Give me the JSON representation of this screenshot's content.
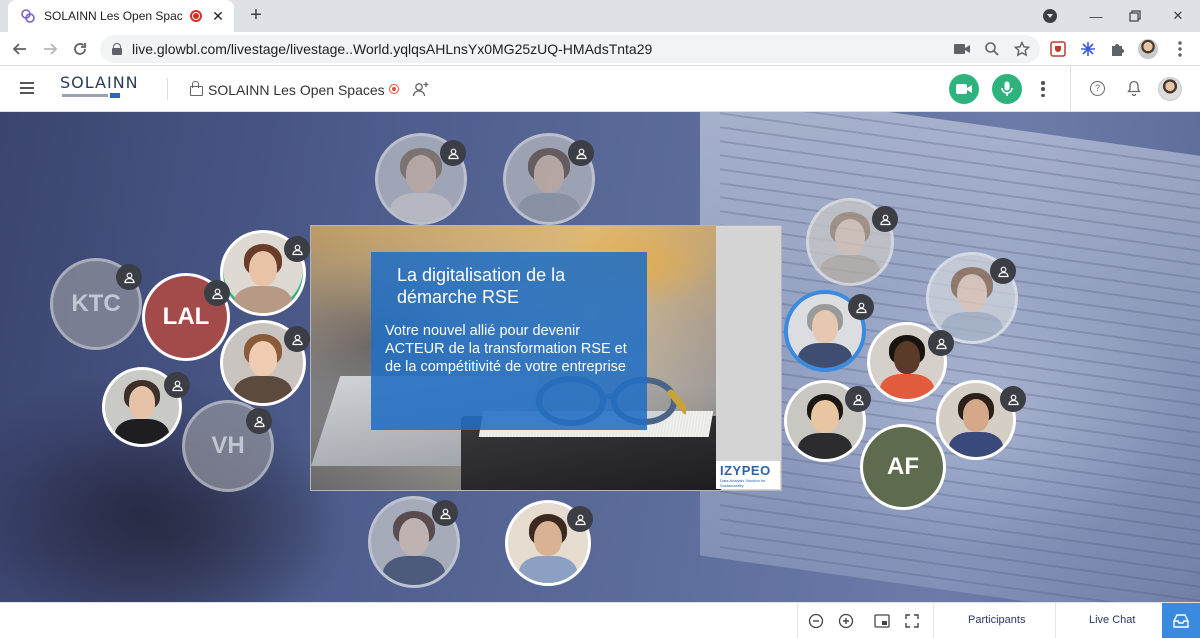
{
  "browser": {
    "tab_title": "SOLAINN Les Open Spaces -",
    "new_tab_label": "+",
    "url": "live.glowbl.com/livestage/livestage..World.yqlqsAHLnsYx0MG25zUQ-HMAdsTnta29"
  },
  "app": {
    "logo_text": "SOLAINN",
    "room_title": "SOLAINN Les Open Spaces"
  },
  "slide": {
    "title_line1": "La digitalisation de la",
    "title_line2": "démarche RSE",
    "body": "Votre nouvel allié pour devenir ACTEUR de la transformation RSE et de la compétitivité de votre entreprise",
    "logo": "IZYPEO",
    "logo_sub": "Data Analysis Solution for Sustainability"
  },
  "participants": [
    {
      "id": "ktc",
      "initials": "KTC",
      "color": "#8d8f9a"
    },
    {
      "id": "lal",
      "initials": "LAL",
      "color": "#a34b4b"
    },
    {
      "id": "vh",
      "initials": "VH",
      "color": "#8d8f9a"
    },
    {
      "id": "af",
      "initials": "AF",
      "color": "#5f6b4e"
    }
  ],
  "bottom": {
    "participants_tab": "Participants",
    "live_chat_tab": "Live Chat"
  }
}
